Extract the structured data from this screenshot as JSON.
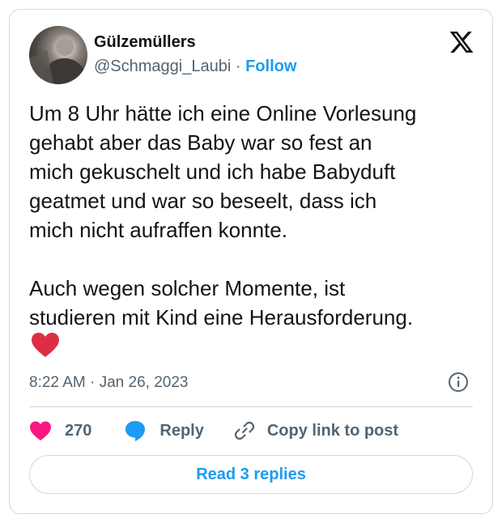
{
  "author": {
    "display_name": "Gülzemüllers",
    "handle": "@Schmaggi_Laubi",
    "separator": "·",
    "follow_label": "Follow",
    "avatar_icon": "user-avatar"
  },
  "platform_icon": "x-logo-icon",
  "tweet": {
    "text": "Um 8 Uhr hätte ich eine Online Vorlesung\ngehabt aber das Baby war so fest an\nmich gekuschelt und ich habe Babyduft\ngeatmet und war so beseelt, dass ich\nmich nicht aufraffen konnte.\n\nAuch wegen solcher Momente, ist\nstudieren mit Kind eine Herausforderung.",
    "emoji": "red-heart-emoji",
    "timestamp": "8:22 AM · Jan 26, 2023"
  },
  "actions": {
    "like_count": "270",
    "reply_label": "Reply",
    "copy_label": "Copy link to post"
  },
  "footer": {
    "read_replies_label": "Read 3 replies"
  },
  "colors": {
    "accent": "#1d9bf0",
    "like": "#f91880",
    "heart_emoji": "#dd2e44",
    "muted": "#536471",
    "border": "#cfd9de"
  }
}
